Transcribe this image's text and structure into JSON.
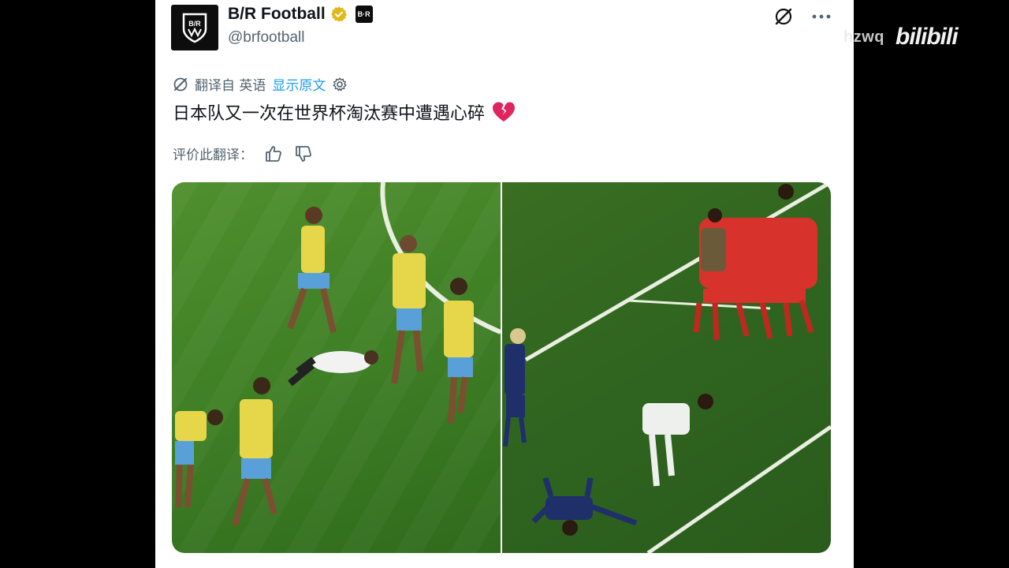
{
  "post": {
    "author_name": "B/R Football",
    "handle": "@brfootball",
    "avatar_text": "B/R",
    "badge_text": "B·R",
    "translate": {
      "label": "翻译自 英语",
      "show_original": "显示原文"
    },
    "text": "日本队又一次在世界杯淘汰赛中遭遇心碎",
    "emoji": "💔",
    "rate_label": "评价此翻译：",
    "images": [
      {
        "name": "left-photo",
        "description_icon": "image"
      },
      {
        "name": "right-photo",
        "description_icon": "image"
      }
    ]
  },
  "watermark": {
    "uid": "hzwq",
    "logo": "bilibili"
  },
  "colors": {
    "accent": "#1d9bf0",
    "text": "#0f1419",
    "muted": "#536471",
    "verified": "#e2b719",
    "heart": "#e0245e"
  },
  "icons": [
    "grok-icon",
    "more-icon",
    "translate-icon",
    "settings-icon",
    "thumbs-up-icon",
    "thumbs-down-icon",
    "verified-badge-icon"
  ]
}
